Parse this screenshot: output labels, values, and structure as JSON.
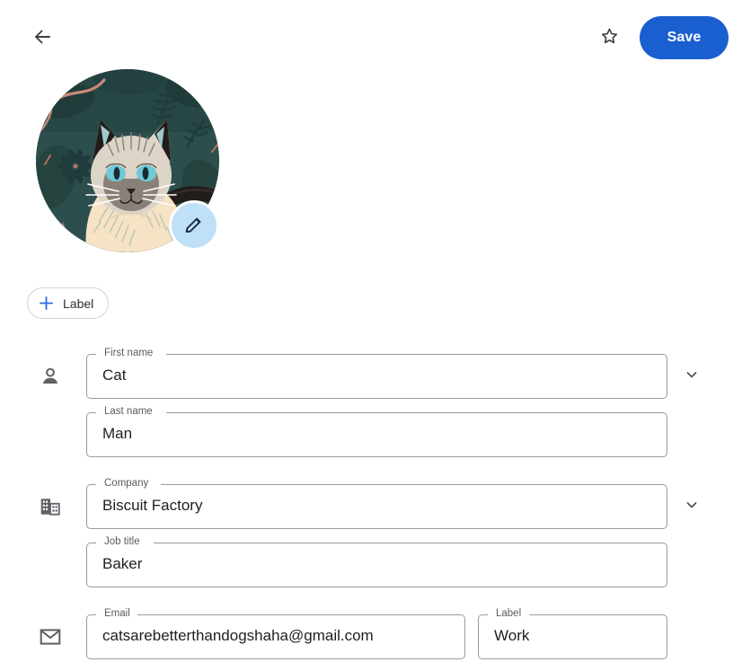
{
  "topbar": {
    "back_icon": "arrow-left-icon",
    "star_icon": "star-outline-icon",
    "save_label": "Save",
    "accent_color": "#1a5fd0"
  },
  "avatar": {
    "alt": "cat-illustration-avatar",
    "edit_icon": "pencil-icon",
    "edit_badge_color": "#bfe0f7",
    "background_color": "#2c4f4d",
    "cat_body_color": "#f6e2c4"
  },
  "add_label_chip": {
    "plus_icon": "plus-icon",
    "label": "Label",
    "plus_color": "#2f68e0"
  },
  "form": {
    "rows": [
      {
        "icon": "person-icon",
        "expand_icon": "chevron-down-icon",
        "fields": [
          {
            "name": "first-name",
            "label": "First name",
            "value": "Cat"
          },
          {
            "name": "last-name",
            "label": "Last name",
            "value": "Man"
          }
        ]
      },
      {
        "icon": "building-icon",
        "expand_icon": "chevron-down-icon",
        "fields": [
          {
            "name": "company",
            "label": "Company",
            "value": "Biscuit Factory"
          },
          {
            "name": "job-title",
            "label": "Job title",
            "value": "Baker"
          }
        ]
      },
      {
        "icon": "email-icon",
        "fields": [
          {
            "name": "email",
            "label": "Email",
            "value": "catsarebetterthandogshaha@gmail.com"
          },
          {
            "name": "email-label",
            "label": "Label",
            "value": "Work"
          }
        ]
      }
    ]
  }
}
